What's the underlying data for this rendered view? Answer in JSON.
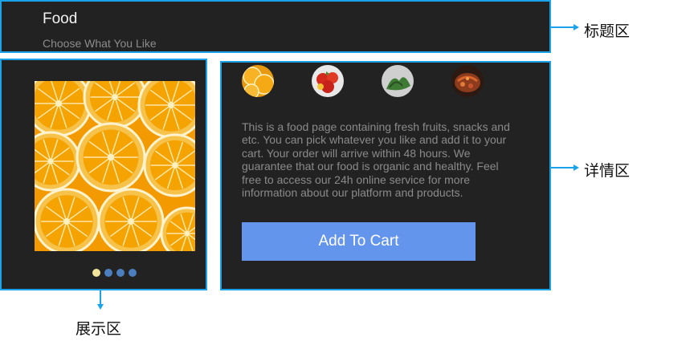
{
  "header": {
    "title": "Food",
    "subtitle": "Choose What You Like"
  },
  "gallery": {
    "main_image_icon": "orange-slices-image",
    "dots": [
      {
        "state": "active"
      },
      {
        "state": "inactive"
      },
      {
        "state": "inactive"
      },
      {
        "state": "inactive"
      }
    ]
  },
  "detail": {
    "thumbnails": [
      {
        "icon": "orange-thumbnail"
      },
      {
        "icon": "tomato-thumbnail"
      },
      {
        "icon": "greens-thumbnail"
      },
      {
        "icon": "dish-thumbnail"
      }
    ],
    "description": "This is a food page containing fresh fruits, snacks and etc. You can pick whatever you like and add it to your cart. Your order will arrive within 48 hours. We guarantee that our food is organic and healthy. Feel free to access our 24h online service for more information about our platform and products.",
    "cart_button_label": "Add To Cart"
  },
  "annotations": {
    "title_area": "标题区",
    "detail_area": "详情区",
    "display_area": "展示区"
  },
  "colors": {
    "panel_background": "#222222",
    "panel_border": "#1aa3e8",
    "button": "#6495ed",
    "dot_active": "#f2e49a",
    "dot_inactive": "#4b7fbf"
  }
}
